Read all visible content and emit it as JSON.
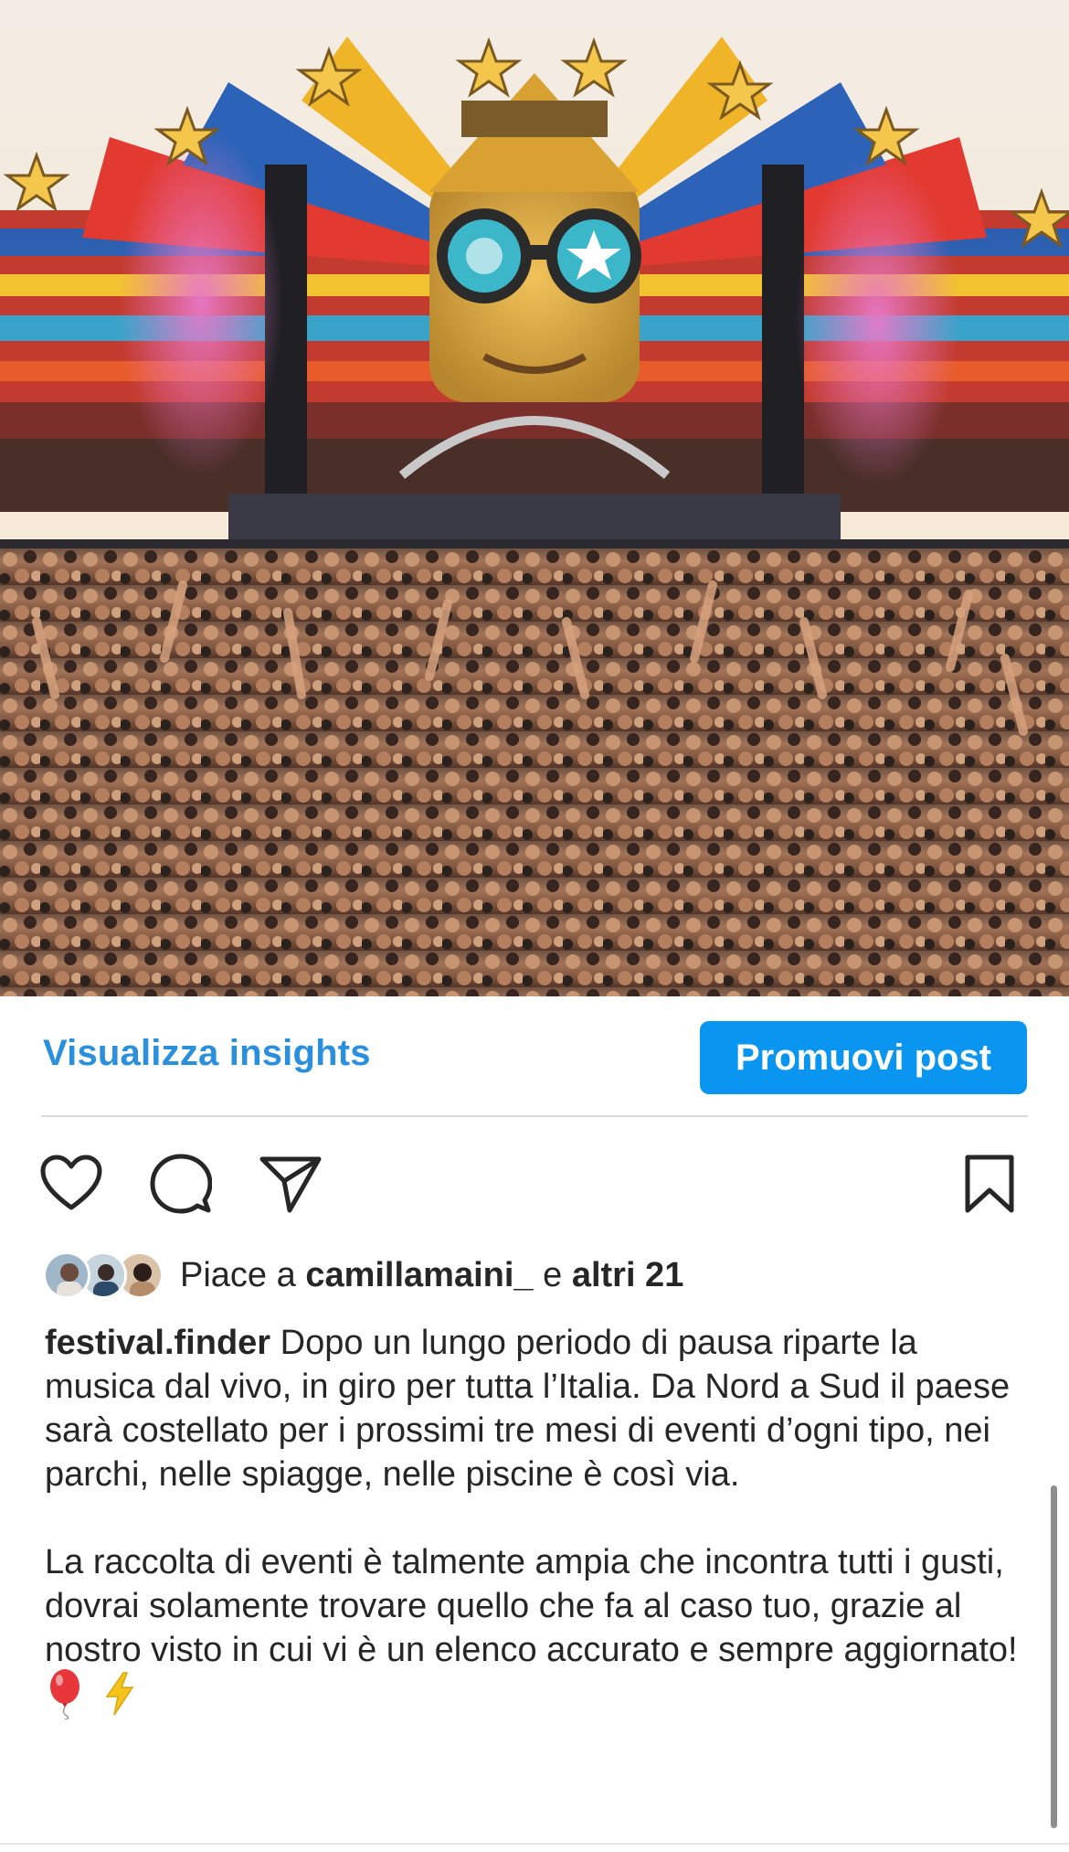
{
  "post": {
    "image_alt": "Festival main stage with giant face and crowd"
  },
  "insights": {
    "view_insights_label": "Visualizza insights",
    "promote_label": "Promuovi post"
  },
  "actions": {
    "like_icon": "heart-icon",
    "comment_icon": "comment-icon",
    "share_icon": "paper-plane-icon",
    "save_icon": "bookmark-icon"
  },
  "likes": {
    "prefix": "Piace a ",
    "user": "camillamaini_",
    "middle": " e ",
    "others": "altri 21"
  },
  "caption": {
    "username": "festival.finder",
    "paragraph1": " Dopo un lungo periodo di pausa riparte la musica dal vivo, in giro per tutta l’Italia. Da Nord a Sud il paese sarà costellato per i prossimi tre mesi di eventi d’ogni tipo, nei parchi, nelle spiagge, nelle piscine è così via.",
    "paragraph2": "La raccolta di eventi è talmente ampia che incontra tutti i gusti, dovrai solamente trovare quello che fa al caso tuo, grazie al nostro visto in cui vi è un elenco accurato e sempre aggiornato!",
    "emojis": [
      "🎈",
      "⚡"
    ]
  },
  "colors": {
    "link_blue": "#2a8fdc",
    "button_blue": "#0a95f0",
    "text": "#262626"
  }
}
